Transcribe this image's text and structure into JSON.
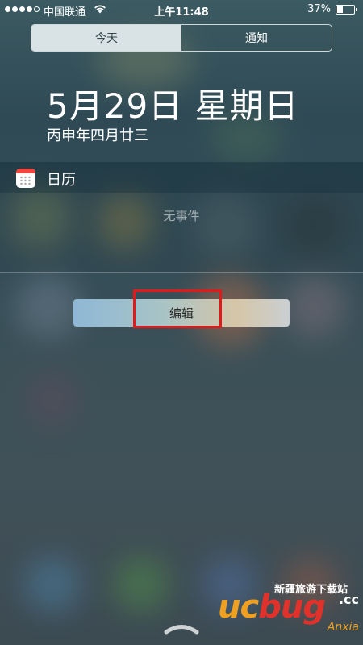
{
  "status_bar": {
    "carrier": "中国联通",
    "time": "上午11:48",
    "battery_percent": "37%",
    "battery_level": 0.37,
    "signal_bars_filled": 4,
    "signal_bars_total": 5
  },
  "tabs": [
    {
      "label": "今天",
      "active": true
    },
    {
      "label": "通知",
      "active": false
    }
  ],
  "date": {
    "main": "5月29日 星期日",
    "lunar": "丙申年四月廿三"
  },
  "calendar_widget": {
    "title": "日历",
    "empty_text": "无事件",
    "icon": "calendar-icon"
  },
  "edit_button": {
    "label": "编辑"
  },
  "watermark": {
    "brand_u": "u",
    "brand_c": "c",
    "brand_rest": "bug",
    "top_text": "新疆旅游下载站",
    "domain_suffix": ".cc",
    "sub_text": "Anxia"
  },
  "colors": {
    "highlight_border": "#e0191b",
    "segment_active_bg": "#d9e3e6",
    "calendar_icon_accent": "#f2453d"
  }
}
